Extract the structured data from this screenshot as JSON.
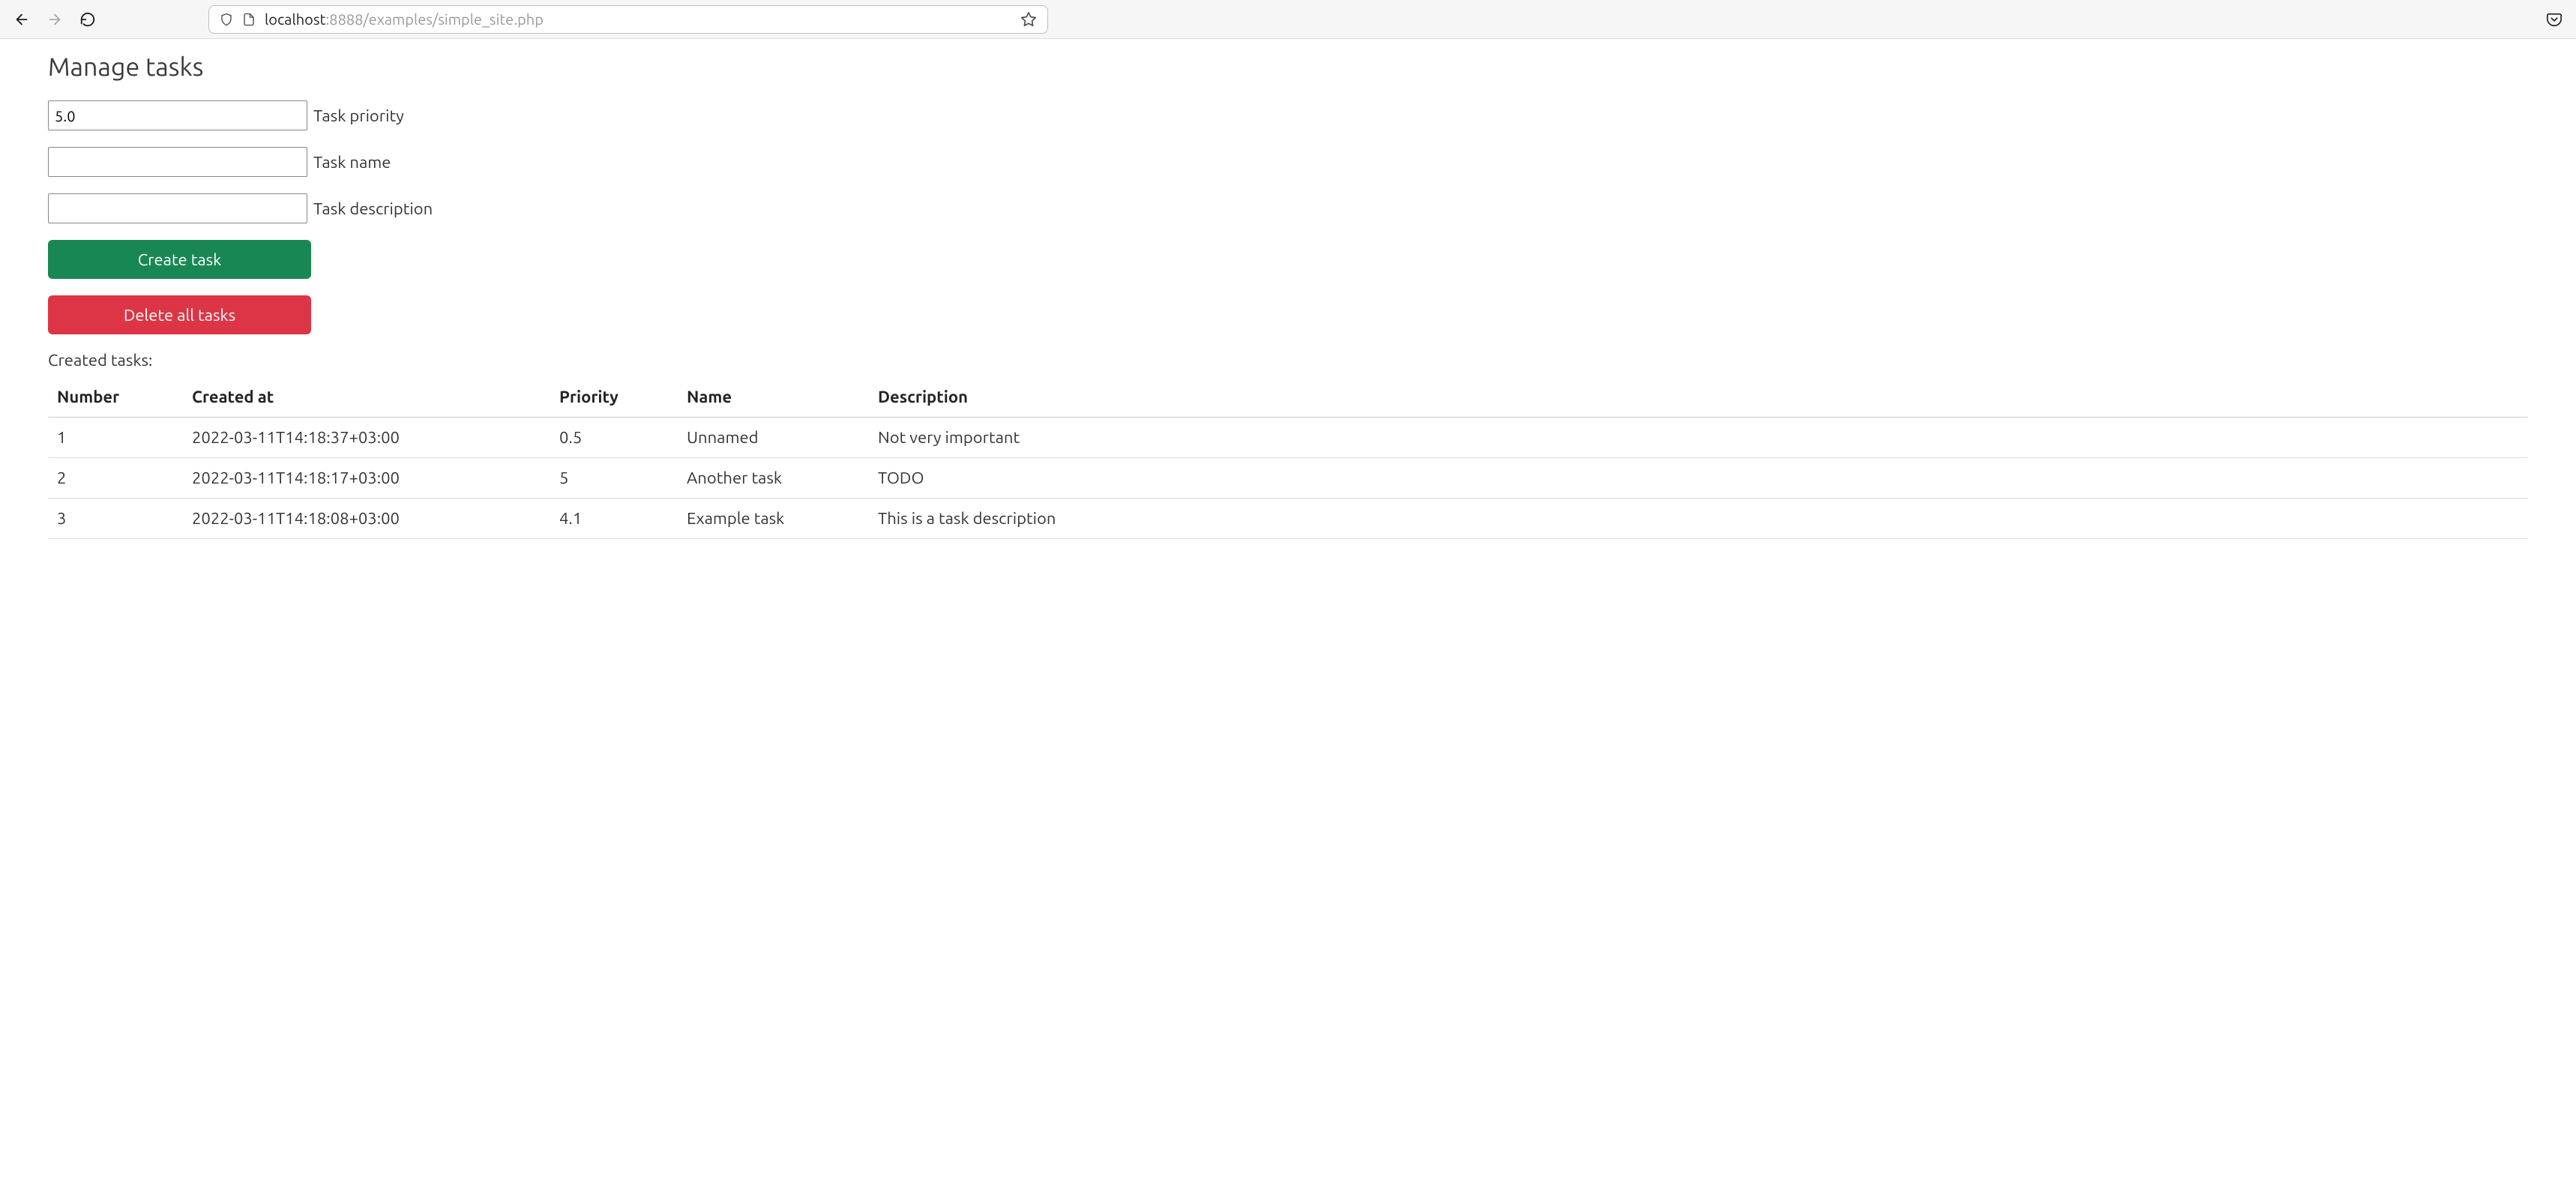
{
  "browser": {
    "url_host": "localhost",
    "url_path": ":8888/examples/simple_site.php"
  },
  "page": {
    "title": "Manage tasks"
  },
  "form": {
    "priority": {
      "value": "5.0",
      "label": "Task priority"
    },
    "name": {
      "value": "",
      "label": "Task name"
    },
    "description": {
      "value": "",
      "label": "Task description"
    },
    "create_button": "Create task",
    "delete_button": "Delete all tasks"
  },
  "tasks": {
    "heading": "Created tasks:",
    "columns": {
      "number": "Number",
      "created_at": "Created at",
      "priority": "Priority",
      "name": "Name",
      "description": "Description"
    },
    "rows": [
      {
        "number": "1",
        "created_at": "2022-03-11T14:18:37+03:00",
        "priority": "0.5",
        "name": "Unnamed",
        "description": "Not very important"
      },
      {
        "number": "2",
        "created_at": "2022-03-11T14:18:17+03:00",
        "priority": "5",
        "name": "Another task",
        "description": "TODO"
      },
      {
        "number": "3",
        "created_at": "2022-03-11T14:18:08+03:00",
        "priority": "4.1",
        "name": "Example task",
        "description": "This is a task description"
      }
    ]
  }
}
